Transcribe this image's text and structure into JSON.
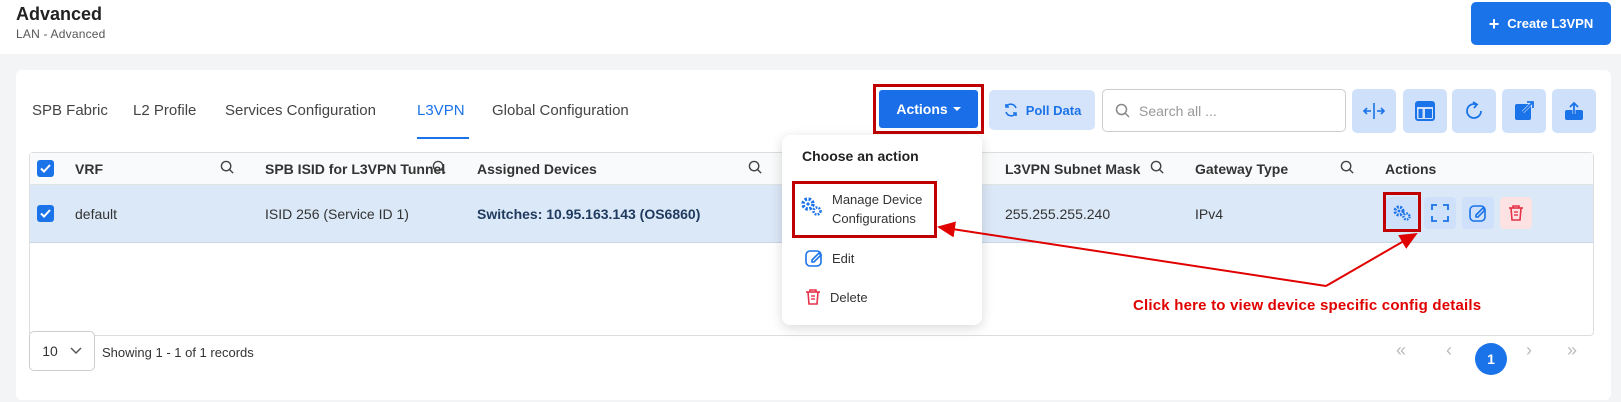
{
  "header": {
    "title": "Advanced",
    "breadcrumb": "LAN  -  Advanced",
    "create_button": "Create L3VPN"
  },
  "tabs": [
    {
      "label": "SPB Fabric"
    },
    {
      "label": "L2 Profile"
    },
    {
      "label": "Services Configuration"
    },
    {
      "label": "L3VPN",
      "active": true
    },
    {
      "label": "Global Configuration"
    }
  ],
  "toolbar": {
    "actions_label": "Actions",
    "poll_label": "Poll Data",
    "search_placeholder": "Search all ..."
  },
  "table": {
    "columns": [
      "VRF",
      "SPB ISID for L3VPN Tunnel",
      "Assigned Devices",
      "L3VPN Subnet Mask",
      "Gateway Type",
      "Actions"
    ],
    "rows": [
      {
        "vrf": "default",
        "isid": "ISID 256 (Service ID 1)",
        "devices": "Switches: 10.95.163.143 (OS6860)",
        "subnet_mask": "255.255.255.240",
        "gateway_type": "IPv4",
        "selected": true
      }
    ]
  },
  "pagination": {
    "page_size": "10",
    "summary": "Showing 1 - 1 of 1 records",
    "current_page": "1"
  },
  "dropdown": {
    "title": "Choose an action",
    "items": [
      {
        "label": "Manage Device Configurations",
        "icon": "gears-icon"
      },
      {
        "label": "Edit",
        "icon": "edit-icon"
      },
      {
        "label": "Delete",
        "icon": "trash-icon"
      }
    ]
  },
  "annotation": "Click here to view device specific config details",
  "colors": {
    "primary": "#1a73e8",
    "highlight_frame": "#c00000",
    "annotation": "#e00000",
    "selected_row": "#dbe8f7"
  }
}
